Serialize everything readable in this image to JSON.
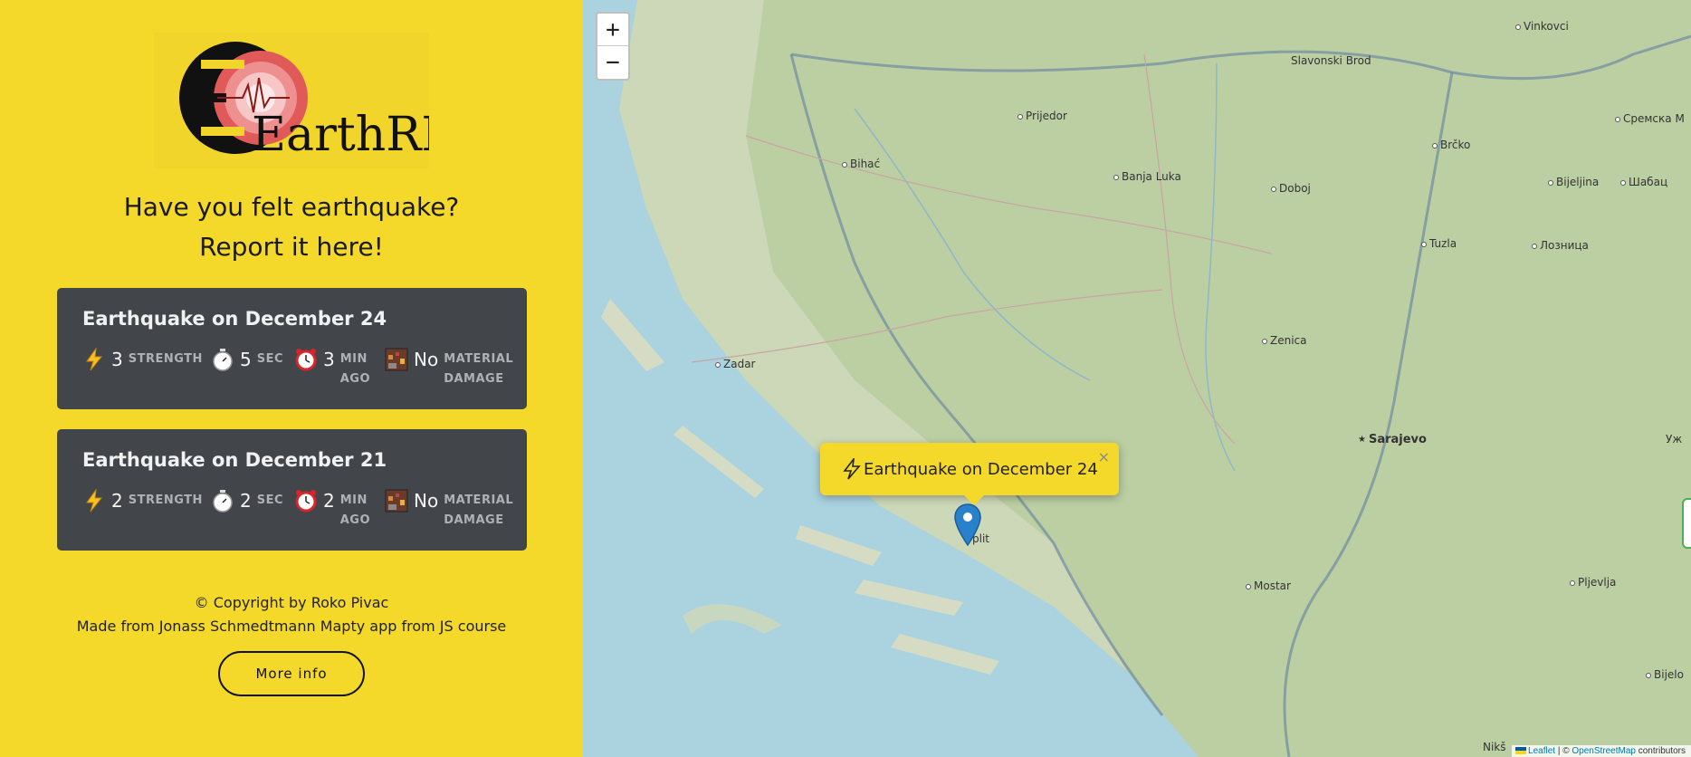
{
  "sidebar": {
    "logo_text": "EarthREP",
    "tagline_line1": "Have you felt earthquake?",
    "tagline_line2": "Report it here!",
    "workouts": [
      {
        "title": "Earthquake on December 24",
        "strength_value": "3",
        "strength_unit": "STRENGTH",
        "duration_value": "5",
        "duration_unit": "SEC",
        "ago_value": "3",
        "ago_unit_line1": "MIN",
        "ago_unit_line2": "AGO",
        "damage_value": "No",
        "damage_unit_line1": "MATERIAL",
        "damage_unit_line2": "DAMAGE"
      },
      {
        "title": "Earthquake on December 21",
        "strength_value": "2",
        "strength_unit": "STRENGTH",
        "duration_value": "2",
        "duration_unit": "SEC",
        "ago_value": "2",
        "ago_unit_line1": "MIN",
        "ago_unit_line2": "AGO",
        "damage_value": "No",
        "damage_unit_line1": "MATERIAL",
        "damage_unit_line2": "DAMAGE"
      }
    ],
    "copyright": "© Copyright by Roko Pivac",
    "credits": "Made from Jonass Schmedtmann Mapty app from JS course",
    "more_info_label": "More info"
  },
  "map": {
    "zoom_in_label": "+",
    "zoom_out_label": "−",
    "popup_text": "Earthquake on December 24",
    "popup_close": "×",
    "cities": {
      "vinkovci": "Vinkovci",
      "slavonski_brod": "Slavonski Brod",
      "prijedor": "Prijedor",
      "bihac": "Bihać",
      "banja_luka": "Banja Luka",
      "doboj": "Doboj",
      "brcko": "Brčko",
      "bijeljina": "Bijeljina",
      "sremska": "Сремска М",
      "sabac": "Шабац",
      "tuzla": "Tuzla",
      "loznica": "Лозница",
      "zenica": "Zenica",
      "zadar": "Zadar",
      "sarajevo": "Sarajevo",
      "uz": "Уж",
      "split": "plit",
      "mostar": "Mostar",
      "pljevlja": "Pljevlja",
      "bijelo": "Bijelo",
      "niksic": "Nikš"
    },
    "attribution": {
      "leaflet": "Leaflet",
      "sep": " | © ",
      "osm": "OpenStreetMap",
      "contributors": " contributors"
    }
  },
  "colors": {
    "sidebar_bg": "#f5d92a",
    "card_bg": "#42464b",
    "sea": "#aad3df",
    "land": "#b9cda0",
    "marker": "#2a81cb"
  }
}
